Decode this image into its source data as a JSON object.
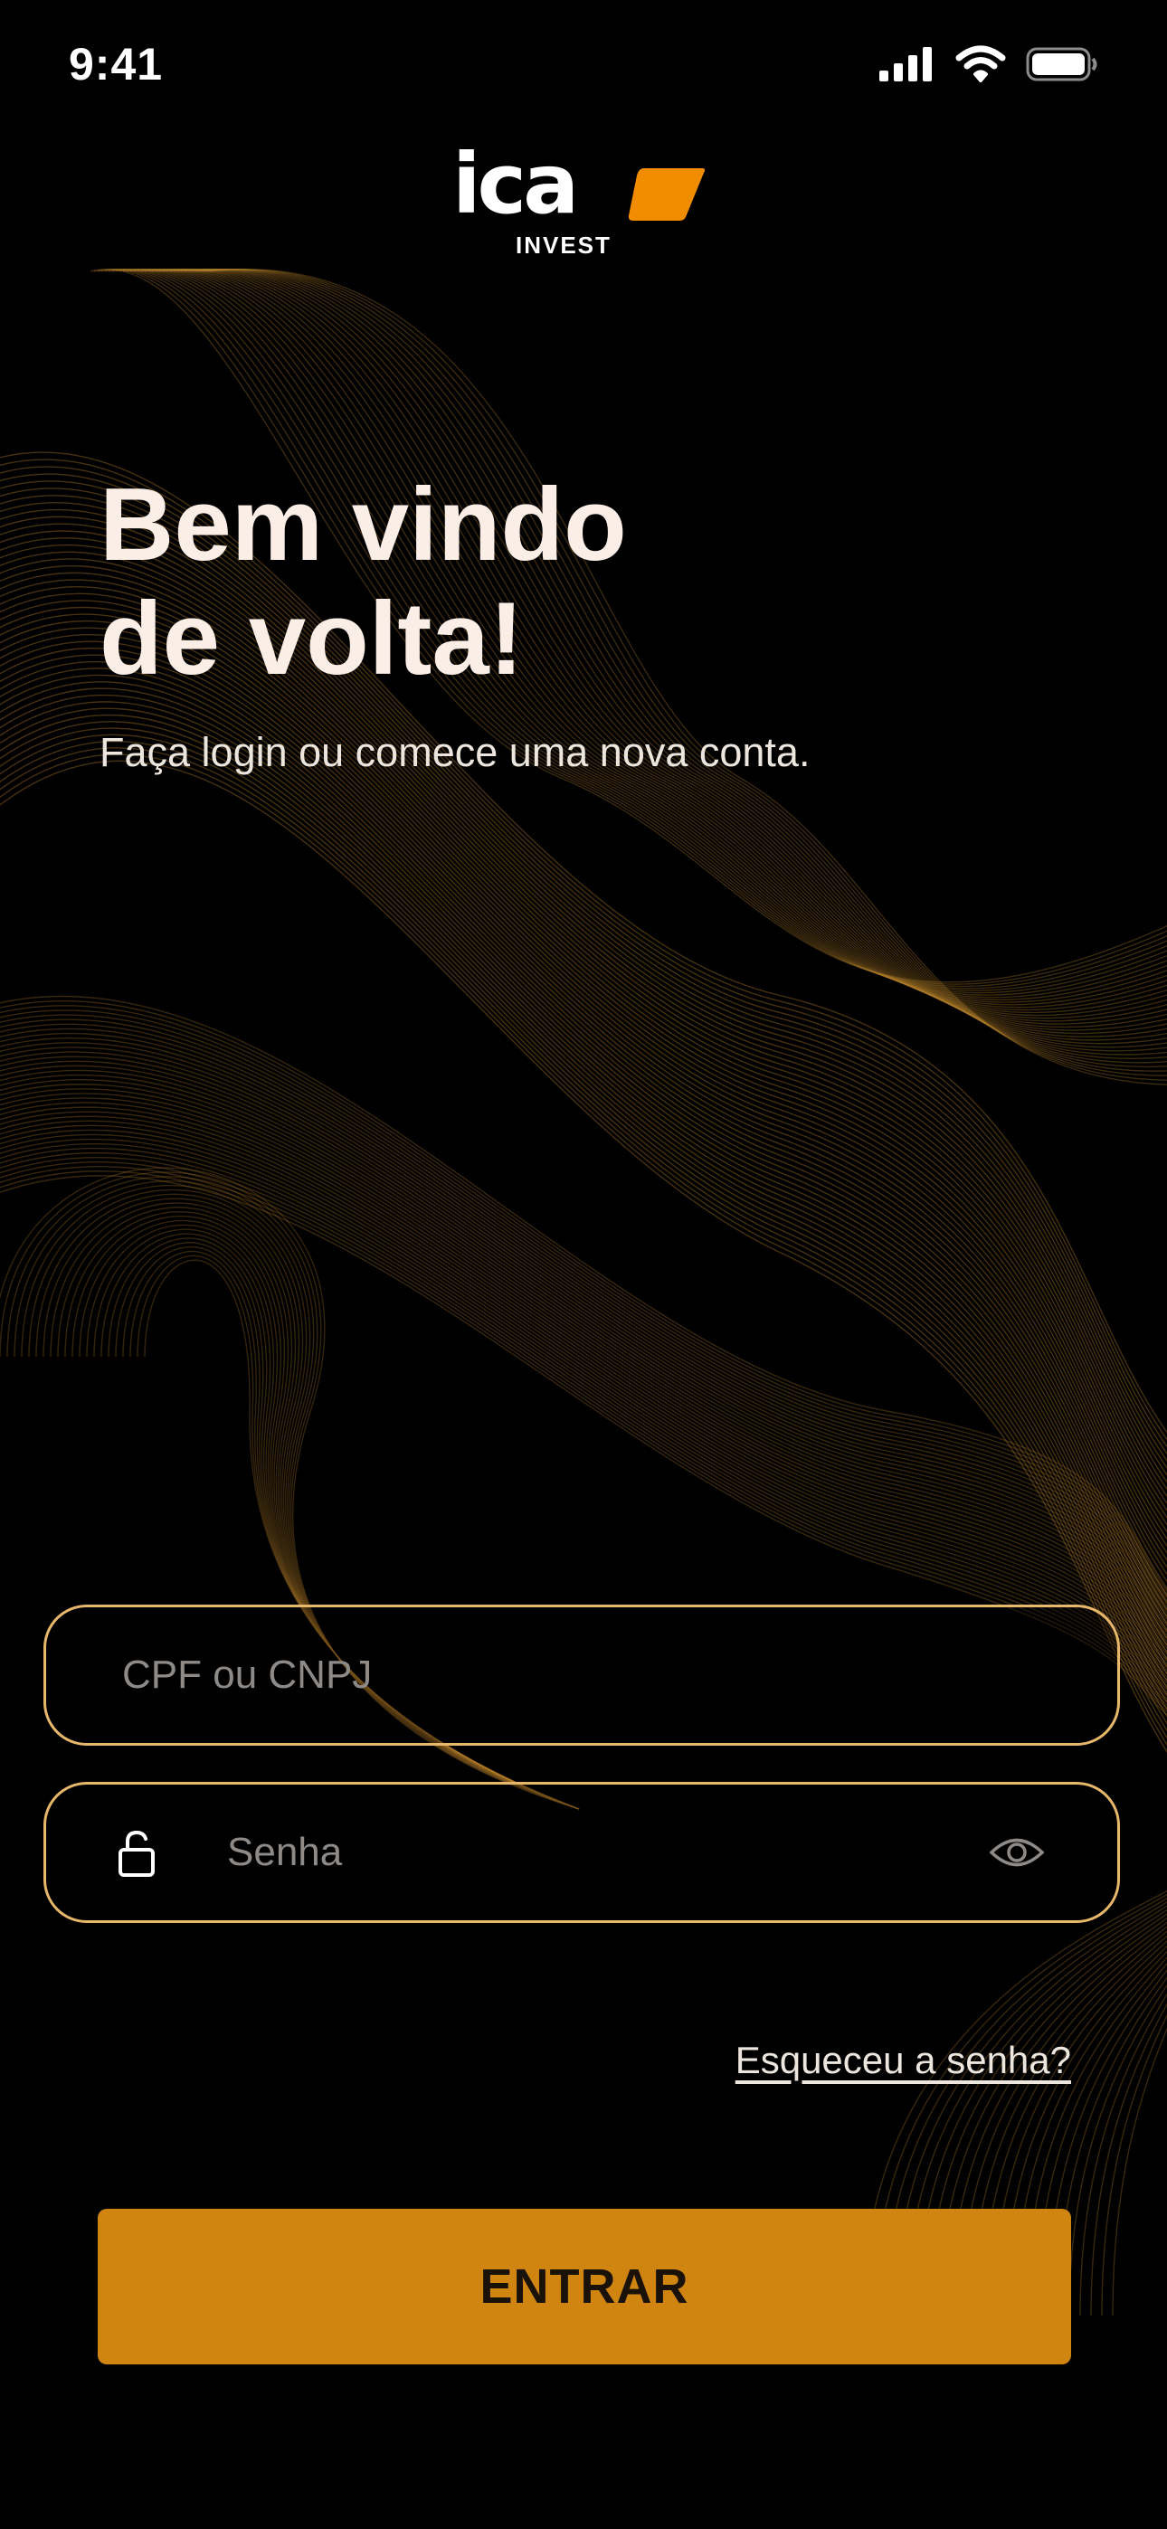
{
  "status_bar": {
    "time": "9:41",
    "icons": [
      "signal-icon",
      "wifi-icon",
      "battery-icon"
    ]
  },
  "brand": {
    "name": "ICA",
    "subtitle": "INVEST",
    "accent_color": "#f28c00"
  },
  "welcome": {
    "title_line1": "Bem vindo",
    "title_line2": "de volta!",
    "subtitle": "Faça login ou comece uma nova conta."
  },
  "form": {
    "document_field": {
      "placeholder": "CPF ou CNPJ",
      "value": ""
    },
    "password_field": {
      "placeholder": "Senha",
      "value": "",
      "leading_icon": "lock-icon",
      "trailing_icon": "eye-icon"
    },
    "forgot_password_label": "Esqueceu a senha?",
    "submit_label": "ENTRAR"
  },
  "colors": {
    "background": "#000000",
    "field_border": "#e7b86a",
    "button": "#d08510",
    "wave_lines": "#b9822a"
  }
}
